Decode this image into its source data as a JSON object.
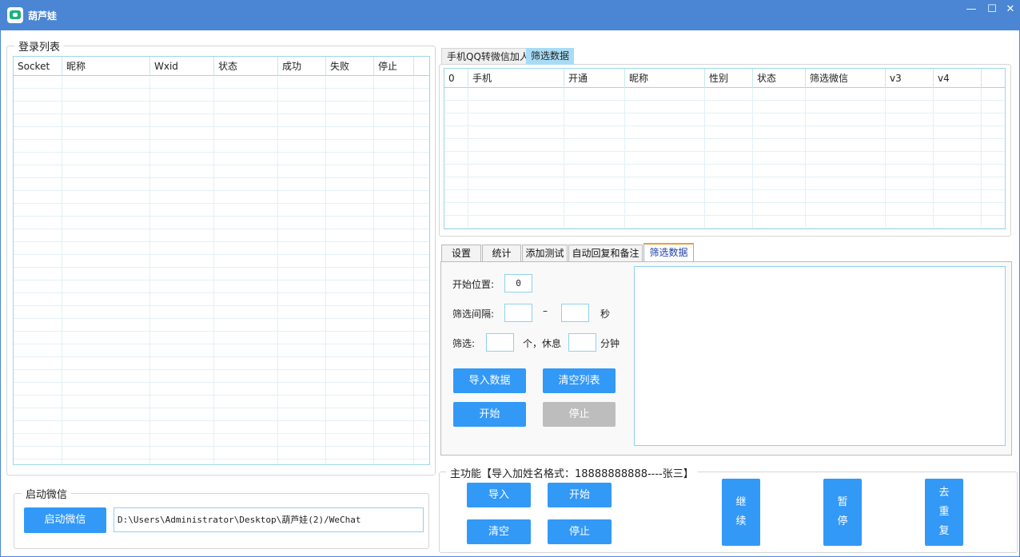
{
  "window": {
    "title": "葫芦娃",
    "minimize": "—",
    "maximize": "☐",
    "close": "✕"
  },
  "login": {
    "title": "登录列表",
    "columns": [
      "Socket",
      "昵称",
      "Wxid",
      "状态",
      "成功",
      "失败",
      "停止"
    ]
  },
  "wechat": {
    "title": "启动微信",
    "button": "启动微信",
    "path": "D:\\Users\\Administrator\\Desktop\\葫芦娃(2)/WeChat"
  },
  "data_tabs": {
    "tab1": "手机QQ转微信加人",
    "tab2": "筛选数据"
  },
  "data_grid": {
    "columns": [
      "0",
      "手机",
      "开通",
      "昵称",
      "性别",
      "状态",
      "筛选微信",
      "v3",
      "v4"
    ]
  },
  "settings_tabs": [
    "设置",
    "统计",
    "添加测试",
    "自动回复和备注",
    "筛选数据"
  ],
  "filter": {
    "start_label": "开始位置:",
    "start_value": "0",
    "interval_label": "筛选间隔:",
    "interval_dash": "–",
    "interval_unit": "秒",
    "batch_label": "筛选:",
    "batch_unit": "个，休息",
    "rest_unit": "分钟",
    "import_btn": "导入数据",
    "clear_btn": "清空列表",
    "start_btn": "开始",
    "stop_btn": "停止"
  },
  "main": {
    "title": "主功能【导入加姓名格式：18888888888----张三】",
    "import_btn": "导入",
    "start_btn": "开始",
    "clear_btn": "清空",
    "stop_btn": "停止",
    "continue_btn": "继\n续",
    "pause_btn": "暂\n停",
    "dedupe_btn": "去\n重\n复"
  }
}
